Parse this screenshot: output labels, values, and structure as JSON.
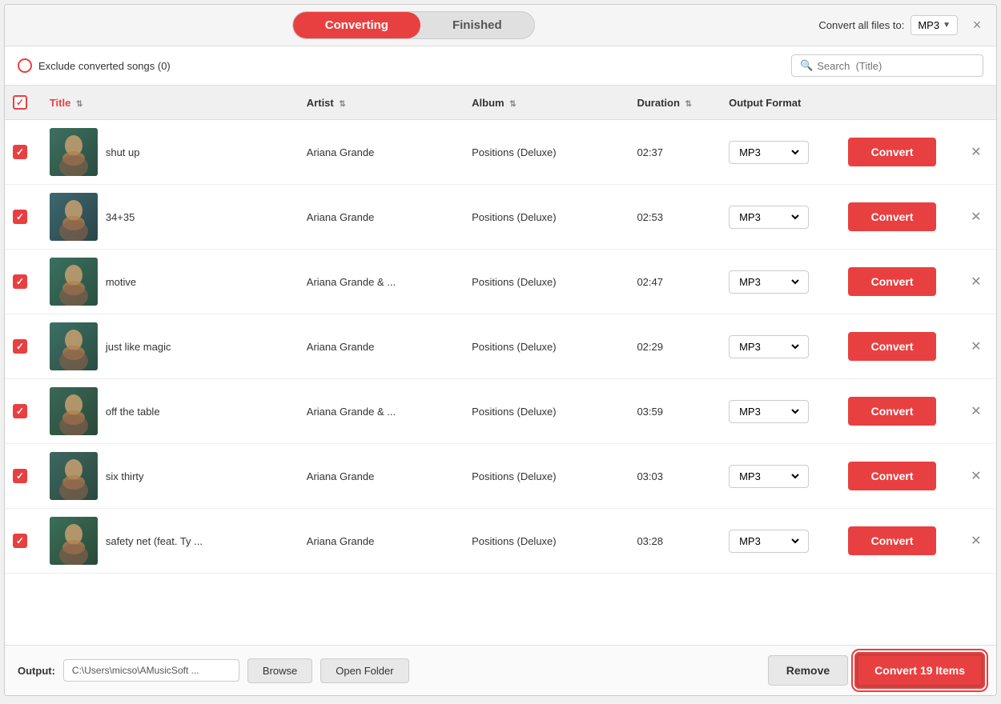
{
  "tabs": {
    "converting": "Converting",
    "finished": "Finished"
  },
  "header": {
    "convert_all_label": "Convert all files to:",
    "format": "MP3",
    "close_label": "×"
  },
  "filter_bar": {
    "exclude_label": "Exclude converted songs (0)",
    "search_placeholder": "Search  (Title)"
  },
  "table": {
    "columns": {
      "title": "Title",
      "artist": "Artist",
      "album": "Album",
      "duration": "Duration",
      "output_format": "Output Format"
    },
    "rows": [
      {
        "id": 1,
        "title": "shut up",
        "artist": "Ariana Grande",
        "album": "Positions (Deluxe)",
        "duration": "02:37",
        "format": "MP3"
      },
      {
        "id": 2,
        "title": "34+35",
        "artist": "Ariana Grande",
        "album": "Positions (Deluxe)",
        "duration": "02:53",
        "format": "MP3"
      },
      {
        "id": 3,
        "title": "motive",
        "artist": "Ariana Grande & ...",
        "album": "Positions (Deluxe)",
        "duration": "02:47",
        "format": "MP3"
      },
      {
        "id": 4,
        "title": "just like magic",
        "artist": "Ariana Grande",
        "album": "Positions (Deluxe)",
        "duration": "02:29",
        "format": "MP3"
      },
      {
        "id": 5,
        "title": "off the table",
        "artist": "Ariana Grande & ...",
        "album": "Positions (Deluxe)",
        "duration": "03:59",
        "format": "MP3"
      },
      {
        "id": 6,
        "title": "six thirty",
        "artist": "Ariana Grande",
        "album": "Positions (Deluxe)",
        "duration": "03:03",
        "format": "MP3"
      },
      {
        "id": 7,
        "title": "safety net (feat. Ty ...",
        "artist": "Ariana Grande",
        "album": "Positions (Deluxe)",
        "duration": "03:28",
        "format": "MP3"
      }
    ],
    "convert_btn_label": "Convert"
  },
  "bottom_bar": {
    "output_label": "Output:",
    "output_path": "C:\\Users\\micso\\AMusicSoft ...",
    "browse_label": "Browse",
    "open_folder_label": "Open Folder",
    "remove_label": "Remove",
    "convert_all_label": "Convert 19 Items"
  },
  "colors": {
    "red": "#e84040",
    "light_gray": "#e8e8e8",
    "border": "#cccccc"
  }
}
